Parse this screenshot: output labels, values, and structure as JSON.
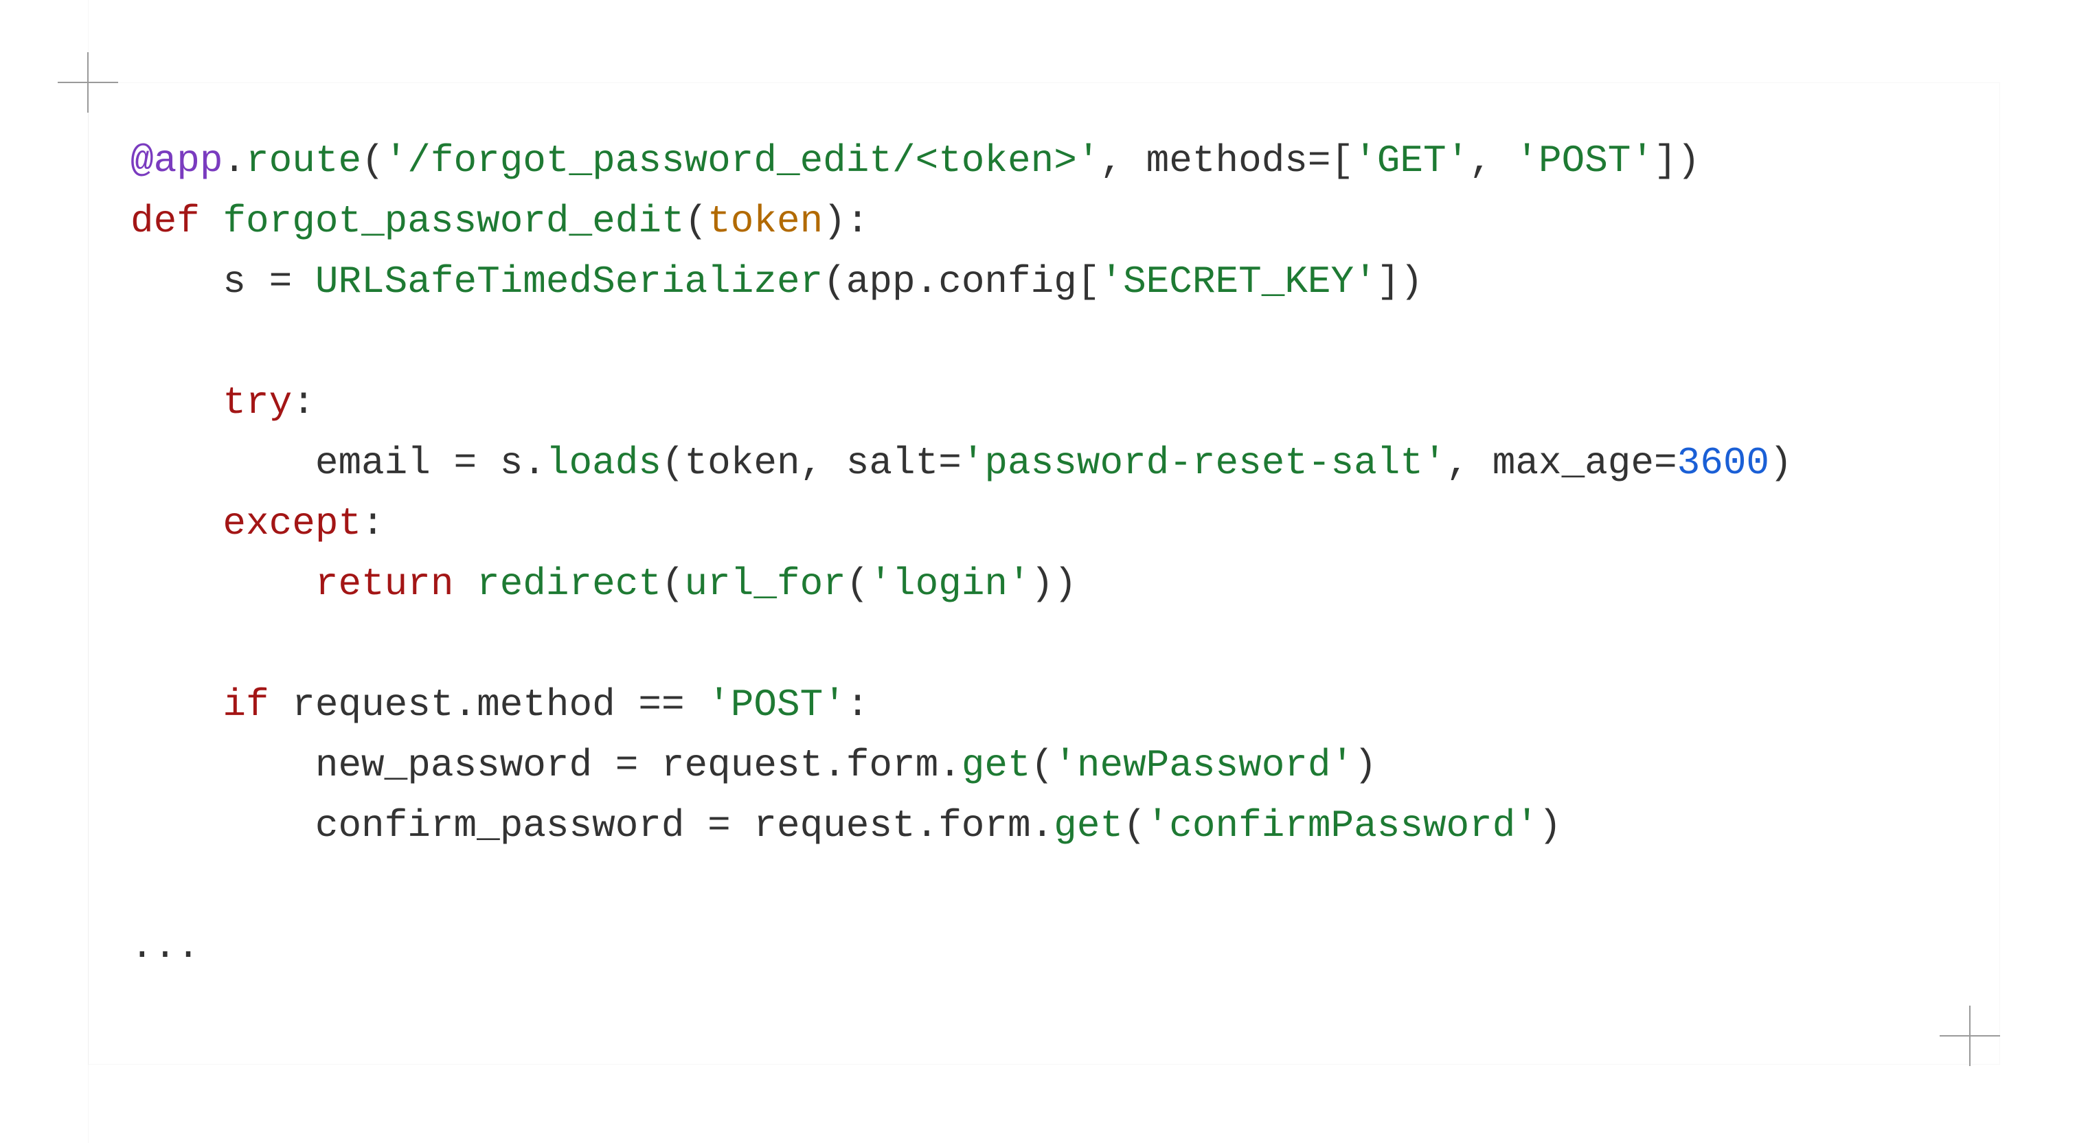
{
  "code": {
    "language": "python",
    "tokens": [
      [
        {
          "t": "@app",
          "c": "tok-decorator"
        },
        {
          "t": ".",
          "c": "tok-attr"
        },
        {
          "t": "route",
          "c": "tok-func"
        },
        {
          "t": "(",
          "c": "tok-op"
        },
        {
          "t": "'/forgot_password_edit/<token>'",
          "c": "tok-string"
        },
        {
          "t": ", methods",
          "c": "tok-plain"
        },
        {
          "t": "=[",
          "c": "tok-op"
        },
        {
          "t": "'GET'",
          "c": "tok-string"
        },
        {
          "t": ", ",
          "c": "tok-op"
        },
        {
          "t": "'POST'",
          "c": "tok-string"
        },
        {
          "t": "])",
          "c": "tok-op"
        }
      ],
      [
        {
          "t": "def",
          "c": "tok-keyword"
        },
        {
          "t": " ",
          "c": "tok-plain"
        },
        {
          "t": "forgot_password_edit",
          "c": "tok-func"
        },
        {
          "t": "(",
          "c": "tok-op"
        },
        {
          "t": "token",
          "c": "tok-param"
        },
        {
          "t": "):",
          "c": "tok-op"
        }
      ],
      [
        {
          "t": "    s ",
          "c": "tok-plain"
        },
        {
          "t": "=",
          "c": "tok-op"
        },
        {
          "t": " ",
          "c": "tok-plain"
        },
        {
          "t": "URLSafeTimedSerializer",
          "c": "tok-func"
        },
        {
          "t": "(app",
          "c": "tok-plain"
        },
        {
          "t": ".",
          "c": "tok-attr"
        },
        {
          "t": "config[",
          "c": "tok-plain"
        },
        {
          "t": "'SECRET_KEY'",
          "c": "tok-string"
        },
        {
          "t": "])",
          "c": "tok-op"
        }
      ],
      [
        {
          "t": "",
          "c": "tok-plain"
        }
      ],
      [
        {
          "t": "    ",
          "c": "tok-plain"
        },
        {
          "t": "try",
          "c": "tok-keyword"
        },
        {
          "t": ":",
          "c": "tok-op"
        }
      ],
      [
        {
          "t": "        email ",
          "c": "tok-plain"
        },
        {
          "t": "=",
          "c": "tok-op"
        },
        {
          "t": " s",
          "c": "tok-plain"
        },
        {
          "t": ".",
          "c": "tok-attr"
        },
        {
          "t": "loads",
          "c": "tok-func"
        },
        {
          "t": "(token, salt",
          "c": "tok-plain"
        },
        {
          "t": "=",
          "c": "tok-op"
        },
        {
          "t": "'password-reset-salt'",
          "c": "tok-string"
        },
        {
          "t": ", max_age",
          "c": "tok-plain"
        },
        {
          "t": "=",
          "c": "tok-op"
        },
        {
          "t": "3600",
          "c": "tok-number"
        },
        {
          "t": ")",
          "c": "tok-op"
        }
      ],
      [
        {
          "t": "    ",
          "c": "tok-plain"
        },
        {
          "t": "except",
          "c": "tok-keyword"
        },
        {
          "t": ":",
          "c": "tok-op"
        }
      ],
      [
        {
          "t": "        ",
          "c": "tok-plain"
        },
        {
          "t": "return",
          "c": "tok-keyword"
        },
        {
          "t": " ",
          "c": "tok-plain"
        },
        {
          "t": "redirect",
          "c": "tok-func"
        },
        {
          "t": "(",
          "c": "tok-op"
        },
        {
          "t": "url_for",
          "c": "tok-func"
        },
        {
          "t": "(",
          "c": "tok-op"
        },
        {
          "t": "'login'",
          "c": "tok-string"
        },
        {
          "t": "))",
          "c": "tok-op"
        }
      ],
      [
        {
          "t": "",
          "c": "tok-plain"
        }
      ],
      [
        {
          "t": "    ",
          "c": "tok-plain"
        },
        {
          "t": "if",
          "c": "tok-keyword"
        },
        {
          "t": " request",
          "c": "tok-plain"
        },
        {
          "t": ".",
          "c": "tok-attr"
        },
        {
          "t": "method ",
          "c": "tok-plain"
        },
        {
          "t": "==",
          "c": "tok-op"
        },
        {
          "t": " ",
          "c": "tok-plain"
        },
        {
          "t": "'POST'",
          "c": "tok-string"
        },
        {
          "t": ":",
          "c": "tok-op"
        }
      ],
      [
        {
          "t": "        new_password ",
          "c": "tok-plain"
        },
        {
          "t": "=",
          "c": "tok-op"
        },
        {
          "t": " request",
          "c": "tok-plain"
        },
        {
          "t": ".",
          "c": "tok-attr"
        },
        {
          "t": "form",
          "c": "tok-plain"
        },
        {
          "t": ".",
          "c": "tok-attr"
        },
        {
          "t": "get",
          "c": "tok-func"
        },
        {
          "t": "(",
          "c": "tok-op"
        },
        {
          "t": "'newPassword'",
          "c": "tok-string"
        },
        {
          "t": ")",
          "c": "tok-op"
        }
      ],
      [
        {
          "t": "        confirm_password ",
          "c": "tok-plain"
        },
        {
          "t": "=",
          "c": "tok-op"
        },
        {
          "t": " request",
          "c": "tok-plain"
        },
        {
          "t": ".",
          "c": "tok-attr"
        },
        {
          "t": "form",
          "c": "tok-plain"
        },
        {
          "t": ".",
          "c": "tok-attr"
        },
        {
          "t": "get",
          "c": "tok-func"
        },
        {
          "t": "(",
          "c": "tok-op"
        },
        {
          "t": "'confirmPassword'",
          "c": "tok-string"
        },
        {
          "t": ")",
          "c": "tok-op"
        }
      ],
      [
        {
          "t": "",
          "c": "tok-plain"
        }
      ],
      [
        {
          "t": "...",
          "c": "tok-ellipsis"
        }
      ]
    ],
    "plain": "@app.route('/forgot_password_edit/<token>', methods=['GET', 'POST'])\ndef forgot_password_edit(token):\n    s = URLSafeTimedSerializer(app.config['SECRET_KEY'])\n\n    try:\n        email = s.loads(token, salt='password-reset-salt', max_age=3600)\n    except:\n        return redirect(url_for('login'))\n\n    if request.method == 'POST':\n        new_password = request.form.get('newPassword')\n        confirm_password = request.form.get('confirmPassword')\n\n..."
  },
  "colors": {
    "keyword": "#a31515",
    "function": "#1e7a33",
    "string": "#1e7a33",
    "decorator": "#7a3bbf",
    "param": "#b26a00",
    "number": "#1a5fd6",
    "plain": "#333333",
    "corner_mark": "#9a9a9a",
    "background": "#ffffff"
  }
}
